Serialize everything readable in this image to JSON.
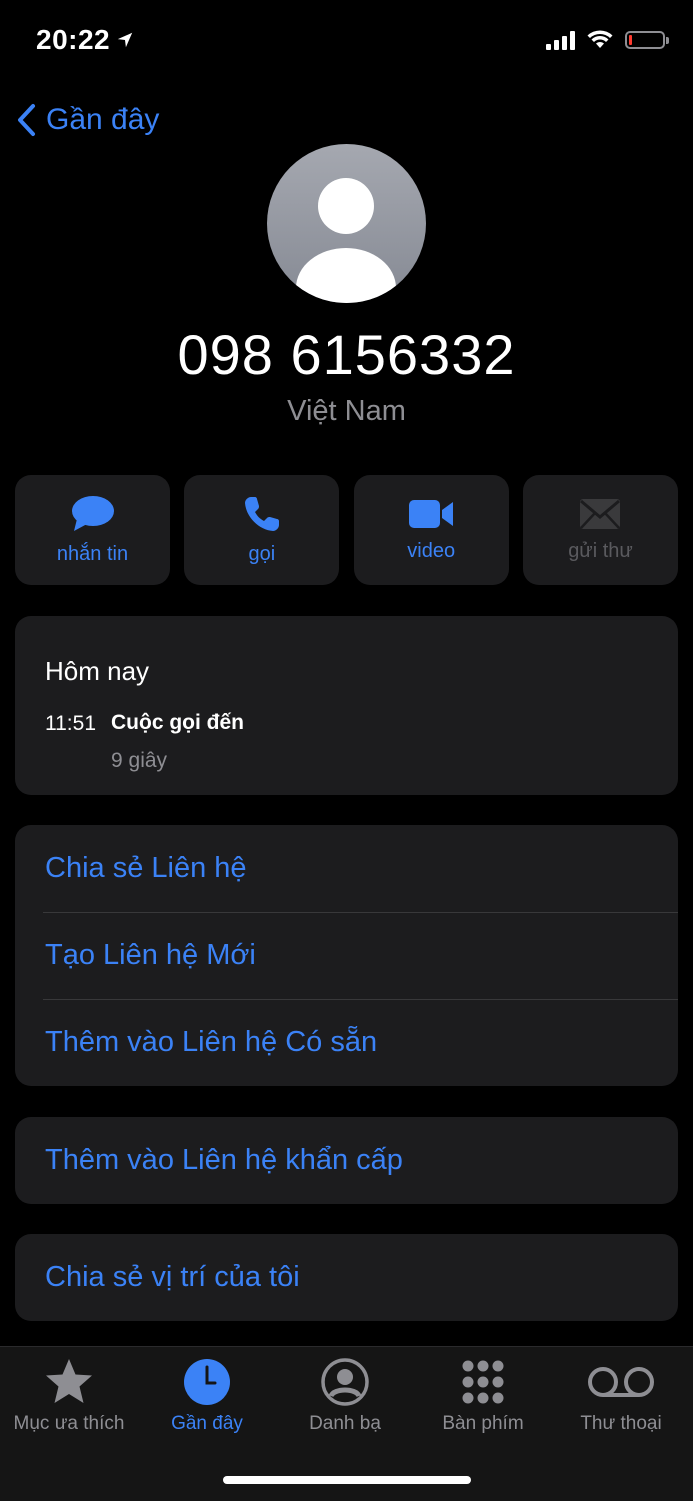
{
  "status_bar": {
    "time": "20:22"
  },
  "nav": {
    "back_label": "Gần đây"
  },
  "contact": {
    "number": "098 6156332",
    "country": "Việt Nam"
  },
  "actions": [
    {
      "label": "nhắn tin",
      "icon": "message-icon",
      "enabled": true
    },
    {
      "label": "gọi",
      "icon": "phone-icon",
      "enabled": true
    },
    {
      "label": "video",
      "icon": "video-icon",
      "enabled": true
    },
    {
      "label": "gửi thư",
      "icon": "mail-icon",
      "enabled": false
    }
  ],
  "history": {
    "title": "Hôm nay",
    "time": "11:51",
    "type": "Cuộc gọi đến",
    "duration": "9 giây"
  },
  "options_group": [
    {
      "label": "Chia sẻ Liên hệ"
    },
    {
      "label": "Tạo Liên hệ Mới"
    },
    {
      "label": "Thêm vào Liên hệ Có sẵn"
    }
  ],
  "emergency_option": {
    "label": "Thêm vào Liên hệ khẩn cấp"
  },
  "location_option": {
    "label": "Chia sẻ vị trí của tôi"
  },
  "tabs": [
    {
      "label": "Mục ưa thích",
      "icon": "star-icon",
      "active": false
    },
    {
      "label": "Gần đây",
      "icon": "clock-icon",
      "active": true
    },
    {
      "label": "Danh bạ",
      "icon": "person-circle-icon",
      "active": false
    },
    {
      "label": "Bàn phím",
      "icon": "keypad-icon",
      "active": false
    },
    {
      "label": "Thư thoại",
      "icon": "voicemail-icon",
      "active": false
    }
  ],
  "colors": {
    "accent": "#3b82f6",
    "background": "#000000",
    "card": "#1c1c1e",
    "secondary_text": "#8e8e93",
    "battery_low": "#ff3b30"
  }
}
